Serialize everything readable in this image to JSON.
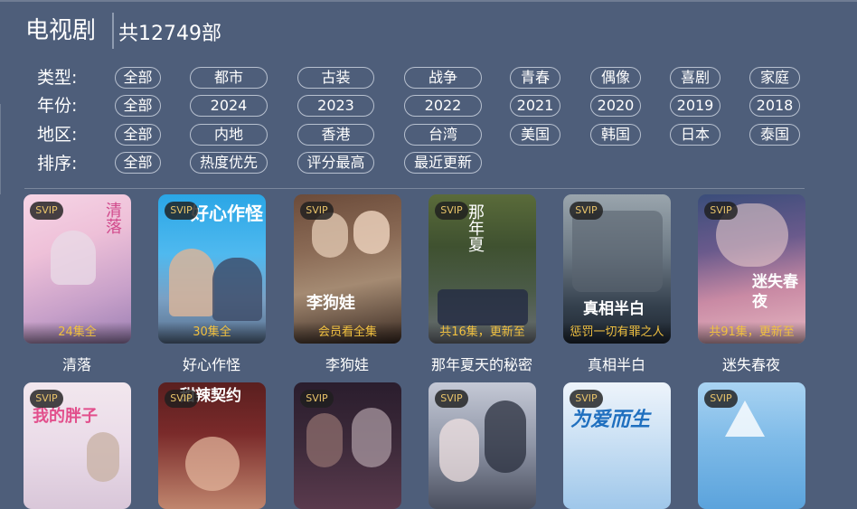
{
  "header": {
    "title": "电视剧",
    "count": "共12749部"
  },
  "filters": {
    "type": {
      "label": "类型:",
      "options": [
        "全部",
        "都市",
        "古装",
        "战争",
        "青春",
        "偶像",
        "喜剧",
        "家庭"
      ]
    },
    "year": {
      "label": "年份:",
      "options": [
        "全部",
        "2024",
        "2023",
        "2022",
        "2021",
        "2020",
        "2019",
        "2018"
      ]
    },
    "region": {
      "label": "地区:",
      "options": [
        "全部",
        "内地",
        "香港",
        "台湾",
        "美国",
        "韩国",
        "日本",
        "泰国"
      ]
    },
    "sort": {
      "label": "排序:",
      "options": [
        "全部",
        "热度优先",
        "评分最高",
        "最近更新"
      ]
    }
  },
  "badge": "SVIP",
  "row1": [
    {
      "title": "清落",
      "status": "24集全"
    },
    {
      "title": "好心作怪",
      "status": "30集全"
    },
    {
      "title": "李狗娃",
      "status": "会员看全集"
    },
    {
      "title": "那年夏天的秘密",
      "status": "共16集，更新至"
    },
    {
      "title": "真相半白",
      "status": "惩罚一切有罪之人"
    },
    {
      "title": "迷失春夜",
      "status": "共91集，更新至"
    }
  ],
  "row2": [
    {},
    {},
    {},
    {},
    {},
    {}
  ],
  "poster_art_text": [
    "清落",
    "好心作怪",
    "李狗娃",
    "那年夏",
    "真相半白",
    "迷失春夜",
    "我的胖子",
    "甜辣契约",
    "",
    "",
    "为爱而生",
    ""
  ],
  "colors": {
    "background": "#4e5e7a",
    "badge_text": "#e9c46a",
    "episode_text": "#f0c040"
  }
}
